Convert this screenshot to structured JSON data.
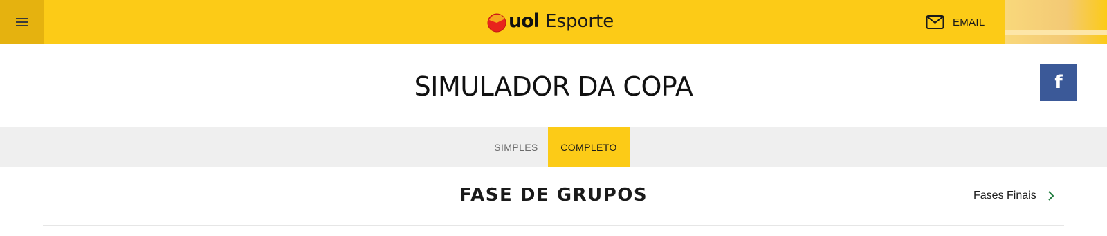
{
  "header": {
    "menu_icon": "hamburger-menu-icon",
    "brand": {
      "logo_text": "uol",
      "section": "Esporte",
      "ball_colors": [
        "#e8231c",
        "#f5a81d"
      ]
    },
    "email": {
      "icon": "envelope-icon",
      "label": "EMAIL"
    },
    "background_color": "#fccb17"
  },
  "page": {
    "title": "SIMULADOR DA COPA",
    "share": {
      "icon": "facebook-icon",
      "glyph": "f",
      "color": "#3b5998"
    }
  },
  "tabs": [
    {
      "label": "SIMPLES",
      "active": false
    },
    {
      "label": "COMPLETO",
      "active": true
    }
  ],
  "phase": {
    "title": "FASE DE GRUPOS",
    "next_link": "Fases Finais",
    "next_icon": "chevron-right-icon",
    "chevron_color": "#1e7a3c"
  }
}
